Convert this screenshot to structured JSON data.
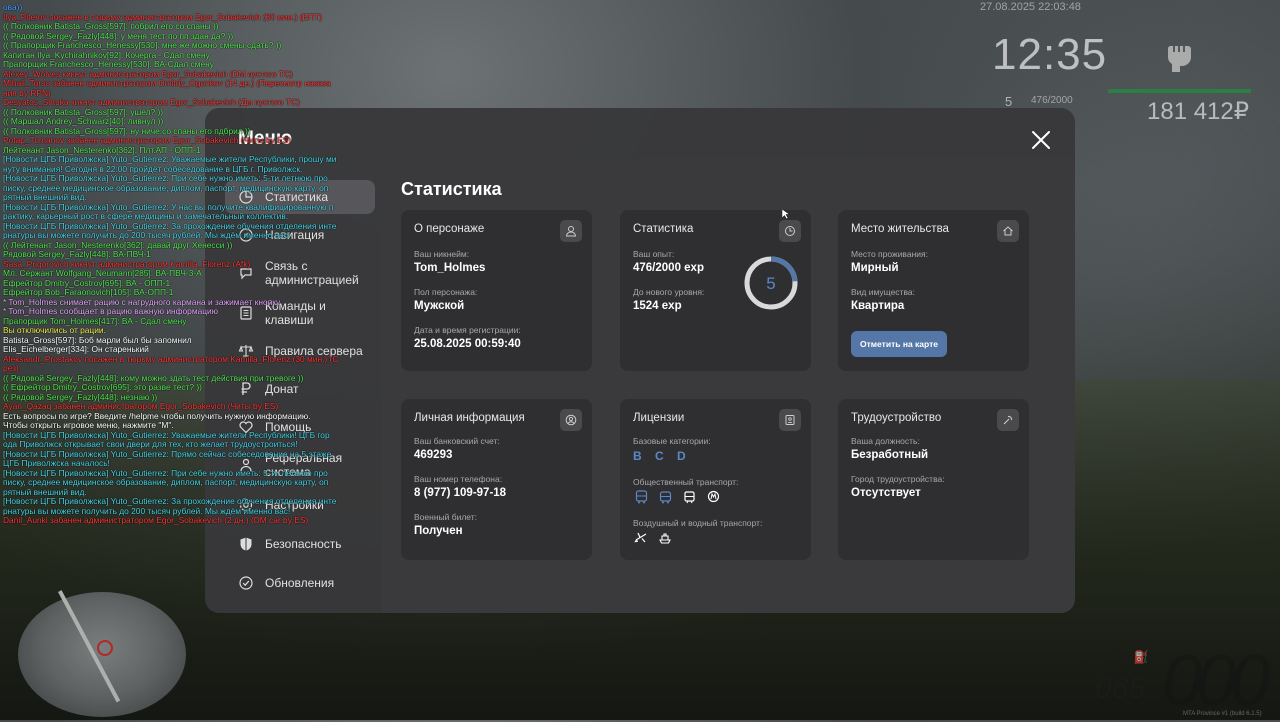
{
  "chat": [
    {
      "text": "ова))",
      "color": "#4fa3ff"
    },
    {
      "text": "Ilya_Piterov посажен в тюрьму администратором Egor_Sobakevich (30 мин.) (ЕПТ)",
      "color": "#ff3a3a"
    },
    {
      "text": "(( Полковник Batista_Gross[597]: побрил его со спаны ))",
      "color": "#55e855"
    },
    {
      "text": "(( Рядовой Sergey_Fazly[448]: у меня тест по пп здан да? ))",
      "color": "#55e855"
    },
    {
      "text": "(( Прапорщик Franchesco_Henessy[530]: мне же можно смены сдать? ))",
      "color": "#55e855"
    },
    {
      "text": "Капитан Ilya_Kychirahnikov[92]: Кочерга - Сдал смену",
      "color": "#55e855"
    },
    {
      "text": "Прапорщик Franchesco_Henessy[530]: ВА-Сдал смену",
      "color": "#55e855"
    },
    {
      "text": "Alexey_Wolves кикнут администратором Egor_Sobakevich (DM пустого ТС)",
      "color": "#ff3a3a"
    },
    {
      "text": "Mihail_Torso забанен администратором Dmitriy_Ogonkov (14 дн.) (Пересмотр наказа",
      "color": "#ff3a3a"
    },
    {
      "text": "ния by RPN)",
      "color": "#ff3a3a"
    },
    {
      "text": "Desyatos_Shtuka кикнут администратором Egor_Sobakevich (Дм пустого ТС)",
      "color": "#ff3a3a"
    },
    {
      "text": "(( Полковник Batista_Gross[597]: ушел? ))",
      "color": "#55e855"
    },
    {
      "text": "(( Маршал Andrey_Schwarz[40]: ливнул ))",
      "color": "#55e855"
    },
    {
      "text": "(( Полковник Batista_Gross[597]: ну ниче.со спаны его пдбрил ))",
      "color": "#55e855"
    },
    {
      "text": "Potap_Tumanov забанен администратором Egor_Sobakevich (Читы by ES)",
      "color": "#ff3a3a"
    },
    {
      "text": "Лейтенант Jason_Nesterenko[362]: Плт.АП - ОПП-1",
      "color": "#55e855"
    },
    {
      "text": "[Новости ЦГБ Приволжска] Yuto_Gutierrez: Уважаемые жители Республики, прошу ми",
      "color": "#49d6e8"
    },
    {
      "text": "нуту внимания! Сегодня в 22:00 пройдёт собеседование в ЦГБ г. Приволжск.",
      "color": "#49d6e8"
    },
    {
      "text": "[Новости ЦГБ Приволжска] Yuto_Gutierrez: При себе нужно иметь: 5-ти летнюю про",
      "color": "#49d6e8"
    },
    {
      "text": "писку, среднее медицинское образование, диплом, паспорт, медицинскую карту, оп",
      "color": "#49d6e8"
    },
    {
      "text": "рятный внешний вид.",
      "color": "#49d6e8"
    },
    {
      "text": "[Новости ЦГБ Приволжска] Yuto_Gutierrez: У нас вы получите квалифицированную п",
      "color": "#49d6e8"
    },
    {
      "text": "рактику, карьерный рост в сфере медицины и замечательный коллектив.",
      "color": "#49d6e8"
    },
    {
      "text": "[Новости ЦГБ Приволжска] Yuto_Gutierrez: За прохождение обучения отделения инте",
      "color": "#49d6e8"
    },
    {
      "text": "рнатуры вы можете получить до 200 тысяч рублей. Мы ждём именно вас!",
      "color": "#49d6e8"
    },
    {
      "text": "(( Лейтенант Jason_Nesterenko[362]: давай друг Хенесси ))",
      "color": "#55e855"
    },
    {
      "text": "Рядовой Sergey_Fazly[448]: ВА-ПВЧ-1",
      "color": "#55e855"
    },
    {
      "text": "Sasa_Prigorovich кикнут администратором Kamilla_Florenz (Afk)",
      "color": "#ff3a3a"
    },
    {
      "text": "Мл. Сержант Wolfgang_Neumann[285]: ВА-ПВЧ-3-А",
      "color": "#55e855"
    },
    {
      "text": "Ефрейтор Dmitry_Costrov[695]: ВА - ОПП-1",
      "color": "#55e855"
    },
    {
      "text": "Ефрейтор Bob_Faraonovich[105]: ВА-ОПП-1",
      "color": "#55e855"
    },
    {
      "text": "* Tom_Holmes снимает рацию с нагрудного кармана и зажимает кнопку",
      "color": "#e7a8ff"
    },
    {
      "text": "* Tom_Holmes сообщает в рацию важную информацию",
      "color": "#e7a8ff"
    },
    {
      "text": "Прапорщик Tom_Holmes[417]: ВА - Сдал смену",
      "color": "#55e855"
    },
    {
      "text": "Вы отключились от рации.",
      "color": "#f2f24d"
    },
    {
      "text": "Batista_Gross[597]: Боб марли был бы запомнил",
      "color": "#ffffff"
    },
    {
      "text": "Elis_Eichelberger[334]: Он старенький",
      "color": "#ffffff"
    },
    {
      "text": "Aleksandr_Prostakov посажен в тюрьму администратором Kamilla_Florenz (30 мин.) (С",
      "color": "#ff3a3a"
    },
    {
      "text": "рез)",
      "color": "#ff3a3a"
    },
    {
      "text": "(( Рядовой Sergey_Fazly[448]: кому можно здать тест действия при тревоге ))",
      "color": "#55e855"
    },
    {
      "text": "(( Ефрейтор Dmitry_Costrov[695]: это разве тест? ))",
      "color": "#55e855"
    },
    {
      "text": "(( Рядовой Sergey_Fazly[448]: незнаю ))",
      "color": "#55e855"
    },
    {
      "text": "Ayan_Qazaq забанен администратором Egor_Sobakevich (Читы by ES)",
      "color": "#ff3a3a"
    },
    {
      "text": "Есть вопросы по игре? Введите /helpme чтобы получить нужную информацию.",
      "color": "#ffffff"
    },
    {
      "text": "Чтобы открыть игровое меню, нажмите \"M\".",
      "color": "#ffffff"
    },
    {
      "text": "[Новости ЦГБ Приволжска] Yuto_Gutierrez: Уважаемые жители Республики! ЦГБ гор",
      "color": "#49d6e8"
    },
    {
      "text": "ода Приволжск открывает свои двери для тех, кто желает трудоустроиться!",
      "color": "#49d6e8"
    },
    {
      "text": "[Новости ЦГБ Приволжска] Yuto_Gutierrez: Прямо сейчас собеседование на 5 этаже",
      "color": "#49d6e8"
    },
    {
      "text": "ЦГБ Приволжска началось!",
      "color": "#49d6e8"
    },
    {
      "text": "[Новости ЦГБ Приволжска] Yuto_Gutierrez: При себе нужно иметь: 5-ти летнюю про",
      "color": "#49d6e8"
    },
    {
      "text": "писку, среднее медицинское образование, диплом, паспорт, медицинскую карту, оп",
      "color": "#49d6e8"
    },
    {
      "text": "рятный внешний вид.",
      "color": "#49d6e8"
    },
    {
      "text": "[Новости ЦГБ Приволжска] Yuto_Gutierrez: За прохождение обучения отделения инте",
      "color": "#49d6e8"
    },
    {
      "text": "рнатуры вы можете получить до 200 тысяч рублей. Мы ждём именно вас!",
      "color": "#49d6e8"
    },
    {
      "text": "Danil_Aunki забанен администратором Egor_Sobakevich (2 дн.) (DM car by ES)",
      "color": "#ff3a3a"
    }
  ],
  "hud": {
    "date": "27.08.2025 22:03:48",
    "time": "12:35",
    "level": "5",
    "exp": "476/2000",
    "money": "181 412₽",
    "speed_big": "000",
    "speed_small": "065",
    "build": "MTA Province #1 (build 6.1.5)"
  },
  "menu": {
    "title": "Меню",
    "sidebar": [
      {
        "label": "Статистика",
        "icon": "pie-chart-icon",
        "active": true
      },
      {
        "label": "Навигация",
        "icon": "compass-icon",
        "active": false
      },
      {
        "label": "Связь с администрацией",
        "icon": "chat-icon",
        "active": false
      },
      {
        "label": "Команды и клавиши",
        "icon": "list-icon",
        "active": false
      },
      {
        "label": "Правила сервера",
        "icon": "scales-icon",
        "active": false
      },
      {
        "label": "Донат",
        "icon": "ruble-icon",
        "active": false
      },
      {
        "label": "Помощь",
        "icon": "help-icon",
        "active": false
      },
      {
        "label": "Реферальная система",
        "icon": "referral-icon",
        "active": false
      },
      {
        "label": "Настройки",
        "icon": "gear-icon",
        "active": false
      },
      {
        "label": "Безопасность",
        "icon": "shield-icon",
        "active": false
      },
      {
        "label": "Обновления",
        "icon": "update-icon",
        "active": false
      }
    ]
  },
  "stats": {
    "title": "Статистика",
    "character": {
      "title": "О персонаже",
      "nick_label": "Ваш никнейм:",
      "nick": "Tom_Holmes",
      "gender_label": "Пол персонажа:",
      "gender": "Мужской",
      "reg_label": "Дата и время регистрации:",
      "reg": "25.08.2025 00:59:40"
    },
    "statistics": {
      "title": "Статистика",
      "exp_label": "Ваш опыт:",
      "exp": "476/2000 exp",
      "next_label": "До нового уровня:",
      "next": "1524 exp",
      "level": "5",
      "progress": 0.238
    },
    "residence": {
      "title": "Место жительства",
      "place_label": "Место проживания:",
      "place": "Мирный",
      "property_label": "Вид имущества:",
      "property": "Квартира",
      "button": "Отметить на карте"
    },
    "personal": {
      "title": "Личная информация",
      "bank_label": "Ваш банковский счет:",
      "bank": "469293",
      "phone_label": "Ваш номер телефона:",
      "phone": "8 (977) 109-97-18",
      "military_label": "Военный билет:",
      "military": "Получен"
    },
    "licenses": {
      "title": "Лицензии",
      "base_label": "Базовые категории:",
      "base": "B C D",
      "public_label": "Общественный транспорт:",
      "air_label": "Воздушный и водный транспорт:"
    },
    "employment": {
      "title": "Трудоустройство",
      "position_label": "Ваша должность:",
      "position": "Безработный",
      "city_label": "Город трудоустройства:",
      "city": "Отсутствует"
    }
  },
  "colors": {
    "accent": "#5577a8",
    "xp_bar": "#2e7d45"
  }
}
